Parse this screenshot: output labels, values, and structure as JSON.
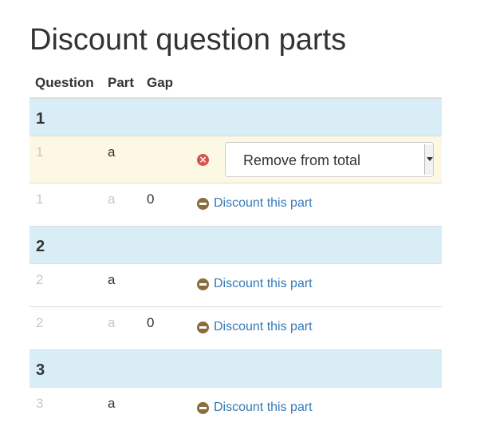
{
  "page_title": "Discount question parts",
  "columns": {
    "question": "Question",
    "part": "Part",
    "gap": "Gap"
  },
  "groups": [
    {
      "label": "1",
      "rows": [
        {
          "question": "1",
          "part": "a",
          "gap": "",
          "state": "discounted",
          "select_value": "Remove from total"
        },
        {
          "question": "1",
          "part": "a",
          "gap": "0",
          "action_label": "Discount this part"
        }
      ]
    },
    {
      "label": "2",
      "rows": [
        {
          "question": "2",
          "part": "a",
          "gap": "",
          "action_label": "Discount this part"
        },
        {
          "question": "2",
          "part": "a",
          "gap": "0",
          "action_label": "Discount this part"
        }
      ]
    },
    {
      "label": "3",
      "rows": [
        {
          "question": "3",
          "part": "a",
          "gap": "",
          "action_label": "Discount this part"
        }
      ]
    }
  ],
  "colors": {
    "group_bg": "#d9edf7",
    "warning_bg": "#fcf8e3",
    "link": "#337ab7",
    "remove_icon": "#d9534f",
    "discount_icon": "#8a6d3b"
  }
}
